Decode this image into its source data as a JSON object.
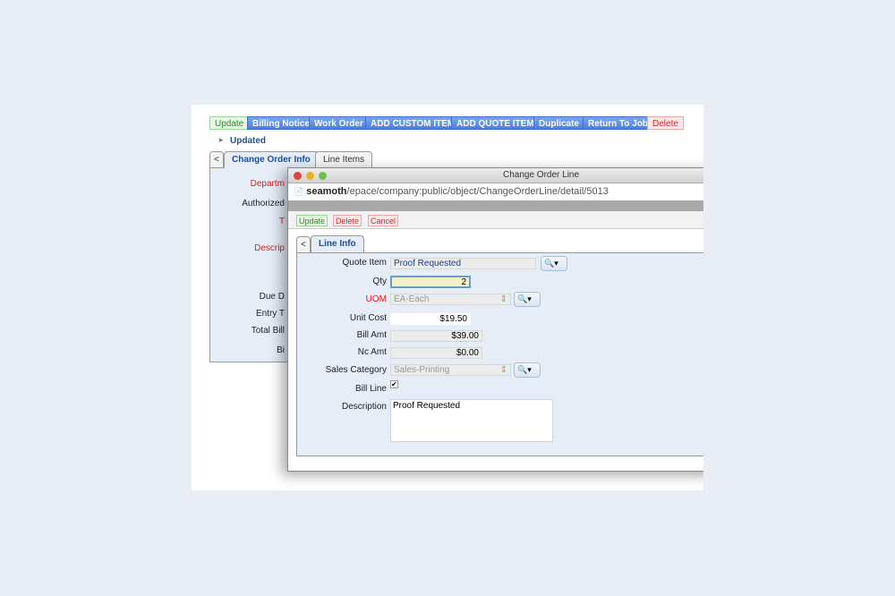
{
  "toolbar": {
    "buttons": [
      "Update",
      "Billing Notice",
      "Work Order",
      "ADD CUSTOM ITEM",
      "ADD QUOTE ITEMS",
      "Duplicate",
      "Return To Job",
      "Delete"
    ]
  },
  "status": "Updated",
  "tabs": {
    "back": "<",
    "items": [
      "Change Order Info",
      "Line Items"
    ]
  },
  "bg_labels": [
    "Departm",
    "Authorized",
    "T",
    "Descrip",
    "Due D",
    "Entry T",
    "Total Bill",
    "Bi"
  ],
  "window": {
    "title": "Change Order Line",
    "url_host": "seamoth",
    "url_path": "/epace/company:public/object/ChangeOrderLine/detail/5013",
    "buttons": [
      "Update",
      "Delete",
      "Cancel"
    ],
    "tab_back": "<",
    "tab": "Line Info",
    "fields": {
      "quote_item": {
        "label": "Quote Item",
        "value": "Proof Requested"
      },
      "qty": {
        "label": "Qty",
        "value": "2"
      },
      "uom": {
        "label": "UOM",
        "value": "EA-Each"
      },
      "unit_cost": {
        "label": "Unit Cost",
        "value": "$19.50"
      },
      "bill_amt": {
        "label": "Bill Amt",
        "value": "$39.00"
      },
      "nc_amt": {
        "label": "Nc Amt",
        "value": "$0.00"
      },
      "sales_category": {
        "label": "Sales Category",
        "value": "Sales-Printing"
      },
      "bill_line": {
        "label": "Bill Line",
        "checked": true,
        "mark": "✔"
      },
      "description": {
        "label": "Description",
        "value": "Proof Requested"
      }
    }
  },
  "icons": {
    "lookup": "🔍",
    "dropdown": "▾",
    "spinner": "⇕",
    "triangle": "▸",
    "doc": "📄"
  }
}
